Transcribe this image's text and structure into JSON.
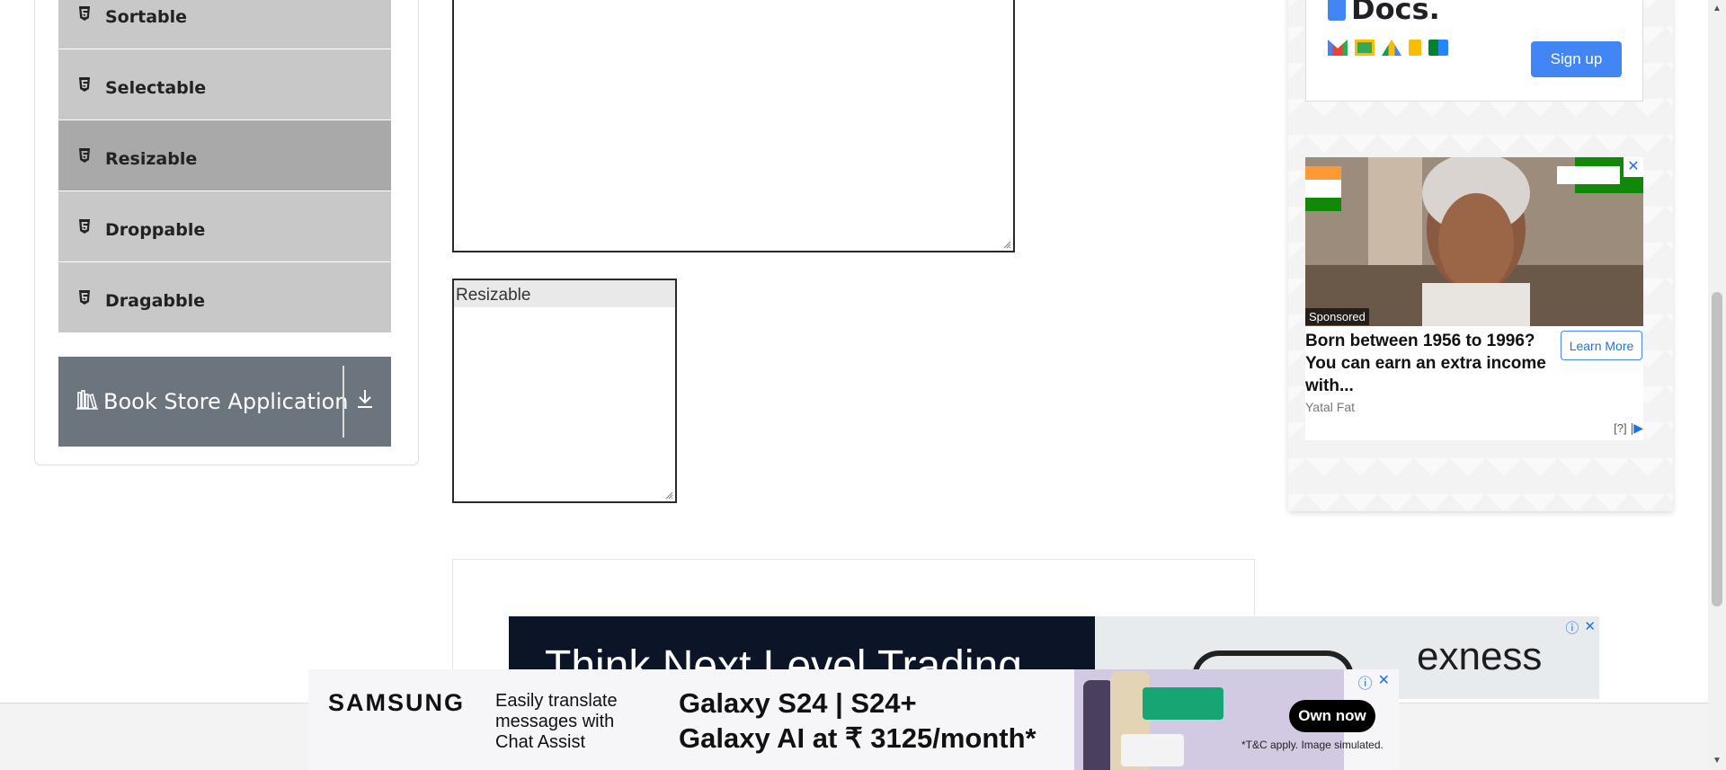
{
  "sidebar": {
    "items": [
      {
        "label": "Sortable",
        "active": false
      },
      {
        "label": "Selectable",
        "active": false
      },
      {
        "label": "Resizable",
        "active": true
      },
      {
        "label": "Droppable",
        "active": false
      },
      {
        "label": "Dragabble",
        "active": false
      }
    ],
    "group_header": {
      "label": "Book Store Application",
      "icon": "book-icon",
      "toggle_icon": "download-arrow-icon"
    }
  },
  "main": {
    "resizable_box_label": "Resizable"
  },
  "ads": {
    "docs": {
      "brand": "Docs.",
      "signup_label": "Sign up"
    },
    "sponsored": {
      "tag": "Sponsored",
      "headline": "Born between 1956 to 1996? You can earn an extra income with...",
      "cta": "Learn More",
      "advertiser": "Yatal Fat",
      "adchoices": "[?]"
    },
    "exness": {
      "tagline": "Think Next Level Trading",
      "logo": "exness"
    },
    "samsung": {
      "brand": "SAMSUNG",
      "message": "Easily translate messages with Chat Assist",
      "line1": "Galaxy S24 | S24+",
      "line2": "Galaxy AI at ₹ 3125/month*",
      "cta": "Own now",
      "fine_print": "*T&C apply. Image simulated."
    }
  },
  "colors": {
    "menu_bg": "#c8c8c8",
    "menu_active_bg": "#a9a9a9",
    "group_header_bg": "#6c757d",
    "ad_blue": "#4285f4"
  }
}
